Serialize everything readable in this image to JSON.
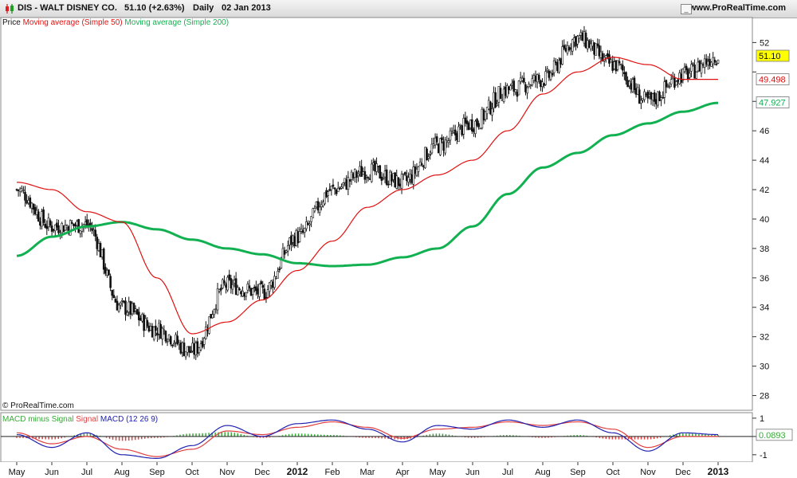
{
  "header": {
    "symbol": "DIS - WALT DISNEY CO.",
    "last": "51.10 (+2.63%)",
    "period": "Daily",
    "date": "02 Jan 2013",
    "site": "www.ProRealTime.com"
  },
  "legend": {
    "price": "Price",
    "ma50": "Moving average (Simple 50)",
    "ma200": "Moving average (Simple 200)"
  },
  "macd_legend": {
    "hist": "MACD minus Signal",
    "signal": "Signal",
    "macd": "MACD (12 26 9)"
  },
  "copyright": "© ProRealTime.com",
  "colors": {
    "candle_up": "#ffffff",
    "candle_down": "#111111",
    "ma50": "#e01010",
    "ma200": "#11b050",
    "macd": "#2020b0",
    "signal": "#e04040",
    "hist_pos": "#3aaa3a",
    "hist_neg": "#e04040"
  },
  "chart_data": [
    {
      "type": "candlestick",
      "title": "DIS - WALT DISNEY CO.",
      "y_ticks": [
        28,
        30,
        32,
        34,
        36,
        38,
        40,
        42,
        44,
        46,
        48,
        50,
        52
      ],
      "y_tick_labels": [
        "28",
        "30",
        "32",
        "34",
        "36",
        "38",
        "40",
        "42",
        "44",
        "46",
        "",
        "",
        "52"
      ],
      "ylim": [
        27,
        53.7
      ],
      "x_tick_labels": [
        "May",
        "Jun",
        "Jul",
        "Aug",
        "Sep",
        "Oct",
        "Nov",
        "Dec",
        "2012",
        "Feb",
        "Mar",
        "Apr",
        "May",
        "Jun",
        "Jul",
        "Aug",
        "Sep",
        "Oct",
        "Nov",
        "Dec",
        "2013"
      ],
      "x_tick_bold": [
        "2012",
        "2013"
      ],
      "x_range": [
        "May 2011",
        "Jan 2013"
      ],
      "price_close_key": [
        [
          "May 2011",
          42.0
        ],
        [
          "Jun 2011",
          39.5
        ],
        [
          "Jul 2011",
          39.6
        ],
        [
          "Aug 2011",
          34.0
        ],
        [
          "Sep 2011",
          32.5
        ],
        [
          "Oct 2011",
          31.0
        ],
        [
          "Nov 2011",
          35.5
        ],
        [
          "Dec 2011",
          35.0
        ],
        [
          "Jan 2012",
          38.8
        ],
        [
          "Feb 2012",
          42.0
        ],
        [
          "Mar 2012",
          43.3
        ],
        [
          "Apr 2012",
          42.5
        ],
        [
          "May 2012",
          45.0
        ],
        [
          "Jun 2012",
          46.5
        ],
        [
          "Jul 2012",
          48.8
        ],
        [
          "Aug 2012",
          49.5
        ],
        [
          "Sep 2012",
          52.3
        ],
        [
          "Oct 2012",
          50.5
        ],
        [
          "Nov 2012",
          48.0
        ],
        [
          "Dec 2012",
          49.8
        ],
        [
          "Jan 2013",
          51.1
        ]
      ],
      "value_labels": [
        {
          "name": "Last price",
          "value": "51.10",
          "bg": "#ffff00"
        },
        {
          "name": "Moving average (Simple 50)",
          "value": "49.498",
          "bg": "#ffffff",
          "color": "#e01010"
        },
        {
          "name": "Moving average (Simple 200)",
          "value": "47.927",
          "bg": "#ffffff",
          "color": "#11b050"
        }
      ],
      "series": [
        {
          "name": "Moving average (Simple 50)",
          "points": [
            [
              "May 2011",
              42.5
            ],
            [
              "Jun 2011",
              42.0
            ],
            [
              "Jul 2011",
              40.5
            ],
            [
              "Aug 2011",
              39.8
            ],
            [
              "Sep 2011",
              36.0
            ],
            [
              "Oct 2011",
              32.2
            ],
            [
              "Nov 2011",
              33.0
            ],
            [
              "Dec 2011",
              34.5
            ],
            [
              "Jan 2012",
              36.5
            ],
            [
              "Feb 2012",
              38.5
            ],
            [
              "Mar 2012",
              40.8
            ],
            [
              "Apr 2012",
              42.0
            ],
            [
              "May 2012",
              43.0
            ],
            [
              "Jun 2012",
              44.0
            ],
            [
              "Jul 2012",
              46.0
            ],
            [
              "Aug 2012",
              48.5
            ],
            [
              "Sep 2012",
              50.0
            ],
            [
              "Oct 2012",
              51.0
            ],
            [
              "Nov 2012",
              50.5
            ],
            [
              "Dec 2012",
              49.5
            ],
            [
              "Jan 2013",
              49.5
            ]
          ]
        },
        {
          "name": "Moving average (Simple 200)",
          "points": [
            [
              "May 2011",
              37.5
            ],
            [
              "Jun 2011",
              38.8
            ],
            [
              "Jul 2011",
              39.5
            ],
            [
              "Aug 2011",
              39.8
            ],
            [
              "Sep 2011",
              39.3
            ],
            [
              "Oct 2011",
              38.6
            ],
            [
              "Nov 2011",
              38.0
            ],
            [
              "Dec 2011",
              37.6
            ],
            [
              "Jan 2012",
              37.0
            ],
            [
              "Feb 2012",
              36.8
            ],
            [
              "Mar 2012",
              36.9
            ],
            [
              "Apr 2012",
              37.4
            ],
            [
              "May 2012",
              38.0
            ],
            [
              "Jun 2012",
              39.5
            ],
            [
              "Jul 2012",
              41.7
            ],
            [
              "Aug 2012",
              43.5
            ],
            [
              "Sep 2012",
              44.5
            ],
            [
              "Oct 2012",
              45.7
            ],
            [
              "Nov 2012",
              46.5
            ],
            [
              "Dec 2012",
              47.3
            ],
            [
              "Jan 2013",
              47.9
            ]
          ]
        }
      ]
    },
    {
      "type": "line",
      "title": "MACD (12 26 9)",
      "y_ticks": [
        -1,
        0,
        1
      ],
      "y_tick_labels": [
        "-1",
        "",
        "1"
      ],
      "ylim": [
        -1.4,
        1.3
      ],
      "value_labels": [
        {
          "name": "MACD minus Signal",
          "value": "0.0893",
          "bg": "#ffffff",
          "color": "#3aaa3a"
        }
      ],
      "series": [
        {
          "name": "MACD (12 26 9)",
          "points": [
            [
              "May 2011",
              0.1
            ],
            [
              "Jun 2011",
              -0.6
            ],
            [
              "Jul 2011",
              0.2
            ],
            [
              "Aug 2011",
              -1.0
            ],
            [
              "Sep 2011",
              -1.2
            ],
            [
              "Oct 2011",
              -0.5
            ],
            [
              "Nov 2011",
              0.6
            ],
            [
              "Dec 2011",
              0.0
            ],
            [
              "Jan 2012",
              0.7
            ],
            [
              "Feb 2012",
              0.9
            ],
            [
              "Mar 2012",
              0.4
            ],
            [
              "Apr 2012",
              -0.3
            ],
            [
              "May 2012",
              0.6
            ],
            [
              "Jun 2012",
              0.4
            ],
            [
              "Jul 2012",
              0.9
            ],
            [
              "Aug 2012",
              0.5
            ],
            [
              "Sep 2012",
              0.9
            ],
            [
              "Oct 2012",
              0.2
            ],
            [
              "Nov 2012",
              -0.8
            ],
            [
              "Dec 2012",
              0.2
            ],
            [
              "Jan 2013",
              0.1
            ]
          ]
        },
        {
          "name": "Signal",
          "points": [
            [
              "May 2011",
              0.2
            ],
            [
              "Jun 2011",
              -0.4
            ],
            [
              "Jul 2011",
              0.0
            ],
            [
              "Aug 2011",
              -0.7
            ],
            [
              "Sep 2011",
              -1.1
            ],
            [
              "Oct 2011",
              -0.7
            ],
            [
              "Nov 2011",
              0.3
            ],
            [
              "Dec 2011",
              0.1
            ],
            [
              "Jan 2012",
              0.5
            ],
            [
              "Feb 2012",
              0.8
            ],
            [
              "Mar 2012",
              0.5
            ],
            [
              "Apr 2012",
              -0.1
            ],
            [
              "May 2012",
              0.4
            ],
            [
              "Jun 2012",
              0.5
            ],
            [
              "Jul 2012",
              0.8
            ],
            [
              "Aug 2012",
              0.6
            ],
            [
              "Sep 2012",
              0.8
            ],
            [
              "Oct 2012",
              0.4
            ],
            [
              "Nov 2012",
              -0.6
            ],
            [
              "Dec 2012",
              0.0
            ],
            [
              "Jan 2013",
              0.0
            ]
          ]
        }
      ]
    }
  ]
}
